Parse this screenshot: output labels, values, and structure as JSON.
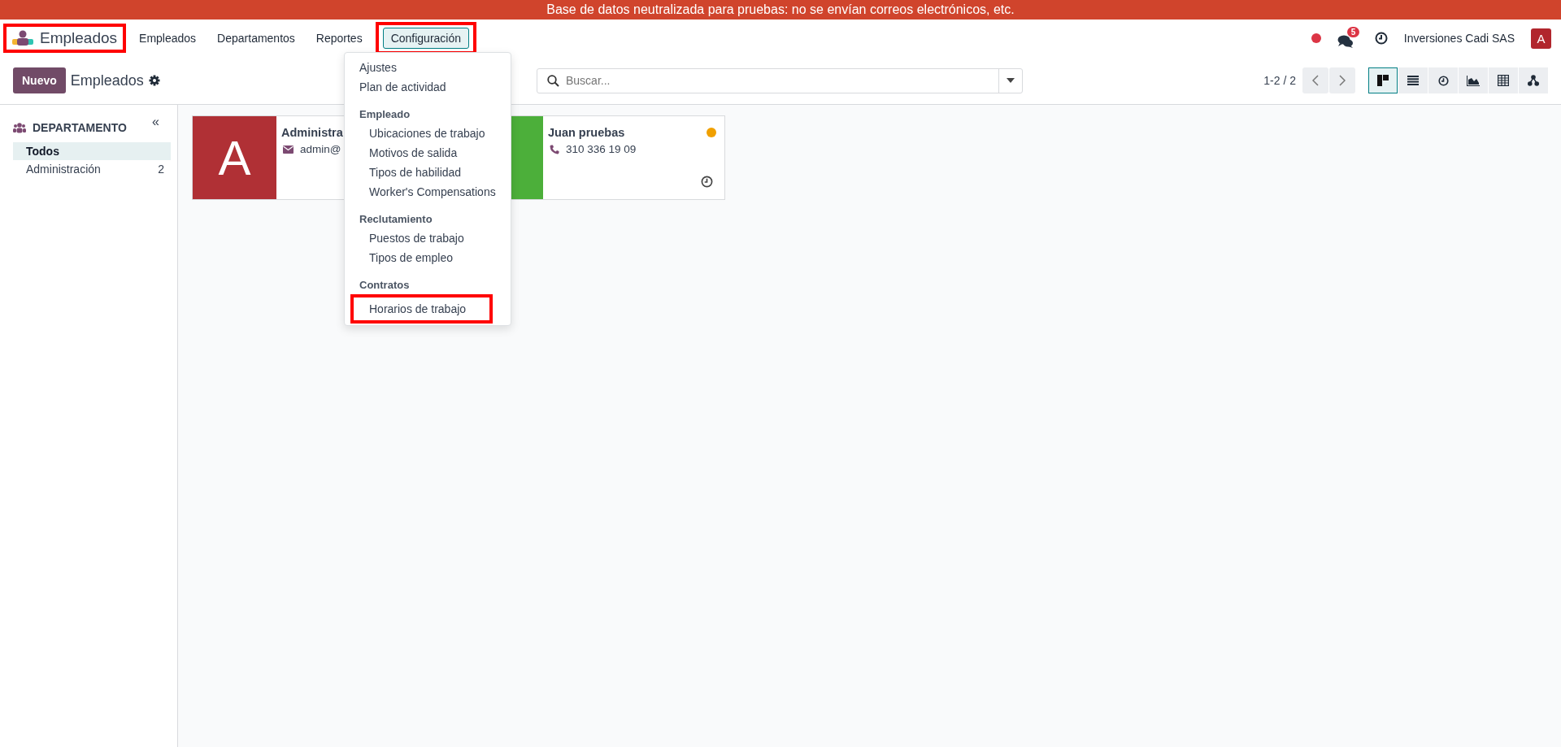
{
  "banner": {
    "text": "Base de datos neutralizada para pruebas: no se envían correos electrónicos, etc."
  },
  "navbar": {
    "brand": {
      "label": "Empleados",
      "highlighted": true
    },
    "menus": [
      {
        "label": "Empleados",
        "selected": false,
        "highlighted": false
      },
      {
        "label": "Departamentos",
        "selected": false,
        "highlighted": false
      },
      {
        "label": "Reportes",
        "selected": false,
        "highlighted": false
      },
      {
        "label": "Configuración",
        "selected": true,
        "highlighted": true
      }
    ],
    "messages_badge": "5",
    "company": "Inversiones Cadi SAS",
    "user_avatar": "A"
  },
  "control_panel": {
    "new_button": "Nuevo",
    "title": "Empleados",
    "search": {
      "placeholder": "Buscar..."
    },
    "pager": "1-2 / 2",
    "views": [
      {
        "kind": "kanban",
        "selected": true
      },
      {
        "kind": "list",
        "selected": false
      },
      {
        "kind": "activity",
        "selected": false
      },
      {
        "kind": "graph",
        "selected": false
      },
      {
        "kind": "pivot",
        "selected": false
      },
      {
        "kind": "hierarchy",
        "selected": false
      }
    ]
  },
  "sidebar": {
    "title": "DEPARTAMENTO",
    "collapse": "«",
    "items": [
      {
        "label": "Todos",
        "selected": true
      },
      {
        "label": "Administración",
        "count": "2",
        "selected": false
      }
    ]
  },
  "cards": [
    {
      "avatar": "A",
      "color": "#b03035",
      "name": "Administra",
      "contact": {
        "kind": "email",
        "text": "admin@"
      }
    },
    {
      "color": "#4caf3a",
      "name": "Juan pruebas",
      "contact": {
        "kind": "phone",
        "text": "310 336 19 09"
      },
      "status_dot": {
        "color": "#f0a000"
      },
      "activity": true
    }
  ],
  "dropdown": {
    "items": [
      {
        "kind": "item",
        "label": "Ajustes",
        "highlighted": false
      },
      {
        "kind": "item",
        "label": "Plan de actividad",
        "highlighted": false
      },
      {
        "kind": "header",
        "label": "Empleado",
        "highlighted": false
      },
      {
        "kind": "subitem",
        "label": "Ubicaciones de trabajo",
        "highlighted": false
      },
      {
        "kind": "subitem",
        "label": "Motivos de salida",
        "highlighted": false
      },
      {
        "kind": "subitem",
        "label": "Tipos de habilidad",
        "highlighted": false
      },
      {
        "kind": "subitem",
        "label": "Worker's Compensations",
        "highlighted": false
      },
      {
        "kind": "header",
        "label": "Reclutamiento",
        "highlighted": false
      },
      {
        "kind": "subitem",
        "label": "Puestos de trabajo",
        "highlighted": false
      },
      {
        "kind": "subitem",
        "label": "Tipos de empleo",
        "highlighted": false
      },
      {
        "kind": "header",
        "label": "Contratos",
        "highlighted": false
      },
      {
        "kind": "subitem",
        "label": "Horarios de trabajo",
        "highlighted": true
      }
    ]
  }
}
